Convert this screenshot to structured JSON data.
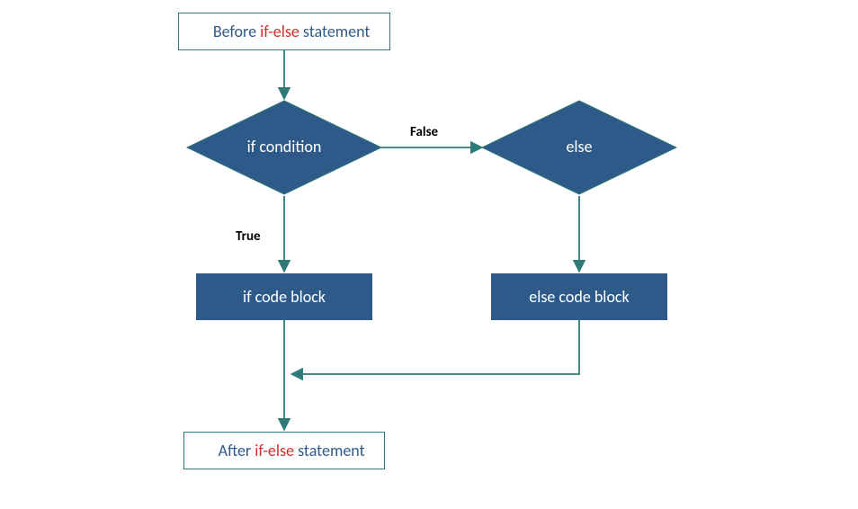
{
  "nodes": {
    "before": {
      "prefix": "Before ",
      "keyword": "if-else",
      "suffix": " statement"
    },
    "ifCondition": "if condition",
    "elseNode": "else",
    "ifBlock": "if code block",
    "elseBlock": "else code block",
    "after": {
      "prefix": "After ",
      "keyword": "if-else",
      "suffix": " statement"
    }
  },
  "edges": {
    "trueLabel": "True",
    "falseLabel": "False"
  },
  "colors": {
    "fill": "#2e5a8a",
    "stroke": "#2e7a7a",
    "keyword": "#d62c2c"
  }
}
